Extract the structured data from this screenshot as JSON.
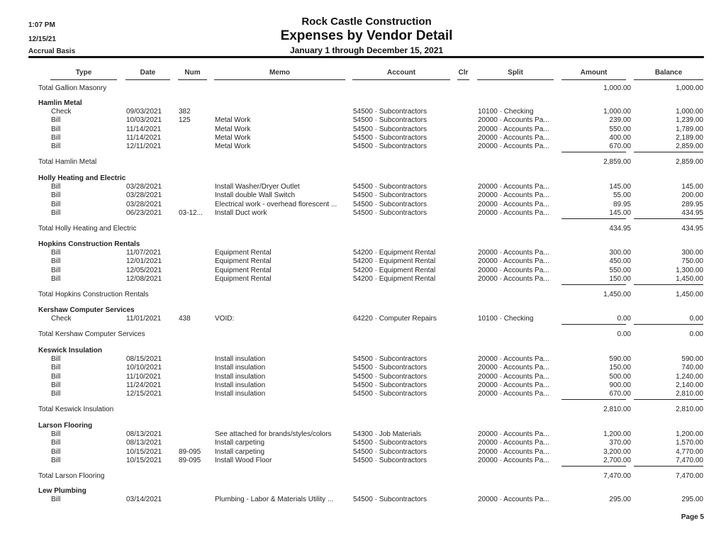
{
  "report": {
    "time": "1:07 PM",
    "date": "12/15/21",
    "basis": "Accrual Basis",
    "company": "Rock Castle Construction",
    "title": "Expenses by Vendor Detail",
    "date_range": "January 1 through December 15, 2021",
    "page": "Page 5"
  },
  "columns": {
    "type": "Type",
    "date": "Date",
    "num": "Num",
    "memo": "Memo",
    "account": "Account",
    "clr": "Clr",
    "split": "Split",
    "amount": "Amount",
    "balance": "Balance"
  },
  "carryover_total": {
    "label": "Total Gallion Masonry",
    "amount": "1,000.00",
    "balance": "1,000.00"
  },
  "vendors": [
    {
      "name": "Hamlin Metal",
      "rows": [
        {
          "type": "Check",
          "date": "09/03/2021",
          "num": "382",
          "memo": "",
          "account": "54500 · Subcontractors",
          "clr": "",
          "split": "10100 · Checking",
          "amount": "1,000.00",
          "balance": "1,000.00"
        },
        {
          "type": "Bill",
          "date": "10/03/2021",
          "num": "125",
          "memo": "Metal Work",
          "account": "54500 · Subcontractors",
          "clr": "",
          "split": "20000 · Accounts Pa...",
          "amount": "239.00",
          "balance": "1,239.00"
        },
        {
          "type": "Bill",
          "date": "11/14/2021",
          "num": "",
          "memo": "Metal Work",
          "account": "54500 · Subcontractors",
          "clr": "",
          "split": "20000 · Accounts Pa...",
          "amount": "550.00",
          "balance": "1,789.00"
        },
        {
          "type": "Bill",
          "date": "11/14/2021",
          "num": "",
          "memo": "Metal Work",
          "account": "54500 · Subcontractors",
          "clr": "",
          "split": "20000 · Accounts Pa...",
          "amount": "400.00",
          "balance": "2,189.00"
        },
        {
          "type": "Bill",
          "date": "12/11/2021",
          "num": "",
          "memo": "Metal Work",
          "account": "54500 · Subcontractors",
          "clr": "",
          "split": "20000 · Accounts Pa...",
          "amount": "670.00",
          "balance": "2,859.00"
        }
      ],
      "total_label": "Total Hamlin Metal",
      "total_amount": "2,859.00",
      "total_balance": "2,859.00"
    },
    {
      "name": "Holly Heating and Electric",
      "rows": [
        {
          "type": "Bill",
          "date": "03/28/2021",
          "num": "",
          "memo": "Install Washer/Dryer Outlet",
          "account": "54500 · Subcontractors",
          "clr": "",
          "split": "20000 · Accounts Pa...",
          "amount": "145.00",
          "balance": "145.00"
        },
        {
          "type": "Bill",
          "date": "03/28/2021",
          "num": "",
          "memo": "Install double Wall Switch",
          "account": "54500 · Subcontractors",
          "clr": "",
          "split": "20000 · Accounts Pa...",
          "amount": "55.00",
          "balance": "200.00"
        },
        {
          "type": "Bill",
          "date": "03/28/2021",
          "num": "",
          "memo": "Electrical work - overhead florescent ...",
          "account": "54500 · Subcontractors",
          "clr": "",
          "split": "20000 · Accounts Pa...",
          "amount": "89.95",
          "balance": "289.95"
        },
        {
          "type": "Bill",
          "date": "06/23/2021",
          "num": "03-12...",
          "memo": "Install Duct work",
          "account": "54500 · Subcontractors",
          "clr": "",
          "split": "20000 · Accounts Pa...",
          "amount": "145.00",
          "balance": "434.95"
        }
      ],
      "total_label": "Total Holly Heating and Electric",
      "total_amount": "434.95",
      "total_balance": "434.95"
    },
    {
      "name": "Hopkins Construction Rentals",
      "rows": [
        {
          "type": "Bill",
          "date": "11/07/2021",
          "num": "",
          "memo": "Equipment Rental",
          "account": "54200 · Equipment Rental",
          "clr": "",
          "split": "20000 · Accounts Pa...",
          "amount": "300.00",
          "balance": "300.00"
        },
        {
          "type": "Bill",
          "date": "12/01/2021",
          "num": "",
          "memo": "Equipment Rental",
          "account": "54200 · Equipment Rental",
          "clr": "",
          "split": "20000 · Accounts Pa...",
          "amount": "450.00",
          "balance": "750.00"
        },
        {
          "type": "Bill",
          "date": "12/05/2021",
          "num": "",
          "memo": "Equipment Rental",
          "account": "54200 · Equipment Rental",
          "clr": "",
          "split": "20000 · Accounts Pa...",
          "amount": "550.00",
          "balance": "1,300.00"
        },
        {
          "type": "Bill",
          "date": "12/08/2021",
          "num": "",
          "memo": "Equipment Rental",
          "account": "54200 · Equipment Rental",
          "clr": "",
          "split": "20000 · Accounts Pa...",
          "amount": "150.00",
          "balance": "1,450.00"
        }
      ],
      "total_label": "Total Hopkins Construction Rentals",
      "total_amount": "1,450.00",
      "total_balance": "1,450.00"
    },
    {
      "name": "Kershaw Computer Services",
      "rows": [
        {
          "type": "Check",
          "date": "11/01/2021",
          "num": "438",
          "memo": "VOID:",
          "account": "64220 · Computer Repairs",
          "clr": "",
          "split": "10100 · Checking",
          "amount": "0.00",
          "balance": "0.00"
        }
      ],
      "total_label": "Total Kershaw Computer Services",
      "total_amount": "0.00",
      "total_balance": "0.00"
    },
    {
      "name": "Keswick Insulation",
      "rows": [
        {
          "type": "Bill",
          "date": "08/15/2021",
          "num": "",
          "memo": "Install insulation",
          "account": "54500 · Subcontractors",
          "clr": "",
          "split": "20000 · Accounts Pa...",
          "amount": "590.00",
          "balance": "590.00"
        },
        {
          "type": "Bill",
          "date": "10/10/2021",
          "num": "",
          "memo": "Install insulation",
          "account": "54500 · Subcontractors",
          "clr": "",
          "split": "20000 · Accounts Pa...",
          "amount": "150.00",
          "balance": "740.00"
        },
        {
          "type": "Bill",
          "date": "11/10/2021",
          "num": "",
          "memo": "Install insulation",
          "account": "54500 · Subcontractors",
          "clr": "",
          "split": "20000 · Accounts Pa...",
          "amount": "500.00",
          "balance": "1,240.00"
        },
        {
          "type": "Bill",
          "date": "11/24/2021",
          "num": "",
          "memo": "Install insulation",
          "account": "54500 · Subcontractors",
          "clr": "",
          "split": "20000 · Accounts Pa...",
          "amount": "900.00",
          "balance": "2,140.00"
        },
        {
          "type": "Bill",
          "date": "12/15/2021",
          "num": "",
          "memo": "Install insulation",
          "account": "54500 · Subcontractors",
          "clr": "",
          "split": "20000 · Accounts Pa...",
          "amount": "670.00",
          "balance": "2,810.00"
        }
      ],
      "total_label": "Total Keswick Insulation",
      "total_amount": "2,810.00",
      "total_balance": "2,810.00"
    },
    {
      "name": "Larson Flooring",
      "rows": [
        {
          "type": "Bill",
          "date": "08/13/2021",
          "num": "",
          "memo": "See attached for brands/styles/colors",
          "account": "54300 · Job Materials",
          "clr": "",
          "split": "20000 · Accounts Pa...",
          "amount": "1,200.00",
          "balance": "1,200.00"
        },
        {
          "type": "Bill",
          "date": "08/13/2021",
          "num": "",
          "memo": "Install carpeting",
          "account": "54500 · Subcontractors",
          "clr": "",
          "split": "20000 · Accounts Pa...",
          "amount": "370.00",
          "balance": "1,570.00"
        },
        {
          "type": "Bill",
          "date": "10/15/2021",
          "num": "89-095",
          "memo": "Install carpeting",
          "account": "54500 · Subcontractors",
          "clr": "",
          "split": "20000 · Accounts Pa...",
          "amount": "3,200.00",
          "balance": "4,770.00"
        },
        {
          "type": "Bill",
          "date": "10/15/2021",
          "num": "89-095",
          "memo": "Install Wood Floor",
          "account": "54500 · Subcontractors",
          "clr": "",
          "split": "20000 · Accounts Pa...",
          "amount": "2,700.00",
          "balance": "7,470.00"
        }
      ],
      "total_label": "Total Larson Flooring",
      "total_amount": "7,470.00",
      "total_balance": "7,470.00"
    },
    {
      "name": "Lew Plumbing",
      "rows": [
        {
          "type": "Bill",
          "date": "03/14/2021",
          "num": "",
          "memo": "Plumbing - Labor & Materials  Utility ...",
          "account": "54500 · Subcontractors",
          "clr": "",
          "split": "20000 · Accounts Pa...",
          "amount": "295.00",
          "balance": "295.00"
        }
      ]
    }
  ]
}
